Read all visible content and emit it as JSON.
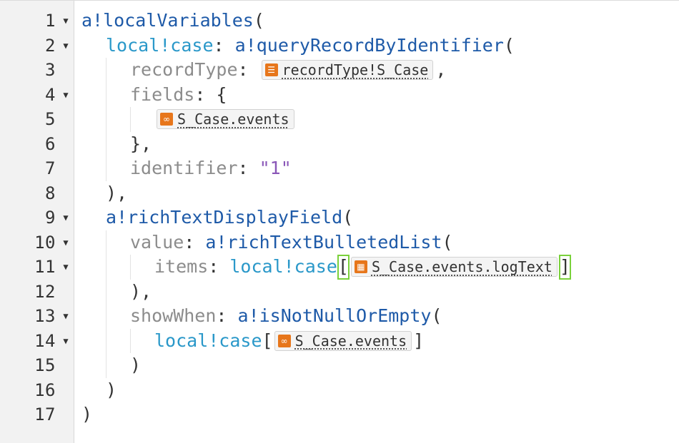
{
  "editor": {
    "lines": [
      {
        "n": "1",
        "fold": true
      },
      {
        "n": "2",
        "fold": true
      },
      {
        "n": "3",
        "fold": false
      },
      {
        "n": "4",
        "fold": true
      },
      {
        "n": "5",
        "fold": false
      },
      {
        "n": "6",
        "fold": false
      },
      {
        "n": "7",
        "fold": false
      },
      {
        "n": "8",
        "fold": false
      },
      {
        "n": "9",
        "fold": true
      },
      {
        "n": "10",
        "fold": true
      },
      {
        "n": "11",
        "fold": true
      },
      {
        "n": "12",
        "fold": false
      },
      {
        "n": "13",
        "fold": true
      },
      {
        "n": "14",
        "fold": true
      },
      {
        "n": "15",
        "fold": false
      },
      {
        "n": "16",
        "fold": false
      },
      {
        "n": "17",
        "fold": false
      }
    ],
    "fold_glyph": "▼",
    "tokens": {
      "l1_fn": "a!localVariables",
      "open_paren": "(",
      "close_paren": ")",
      "l2_var": "local!case",
      "colon": ": ",
      "l2_fn": "a!queryRecordByIdentifier",
      "l3_key": "recordType",
      "l3_chip": "recordType!S_Case",
      "comma": ",",
      "l4_key": "fields",
      "open_brace": "{",
      "l5_chip": "S_Case.events",
      "l6_close": "},",
      "l7_key": "identifier",
      "l7_value": "\"1\"",
      "close_comma": "),",
      "l9_fn": "a!richTextDisplayField",
      "l10_key": "value",
      "l10_fn": "a!richTextBulletedList",
      "l11_key": "items",
      "l11_var": "local!case",
      "open_bracket": "[",
      "close_bracket": "]",
      "l11_chip": "S_Case.events.logText",
      "l13_key": "showWhen",
      "l13_fn": "a!isNotNullOrEmpty",
      "l14_var": "local!case",
      "l14_chip": "S_Case.events"
    }
  },
  "colors": {
    "function": "#1e5aa8",
    "variable": "#2a98c9",
    "keyword": "#8c8c8c",
    "string": "#8a57b8",
    "chip_icon": "#e7761b",
    "bracket_match": "#7ad13b"
  },
  "icons": {
    "record_type": "record-type-icon",
    "relationship": "link-relationship-icon",
    "field": "record-field-icon"
  }
}
